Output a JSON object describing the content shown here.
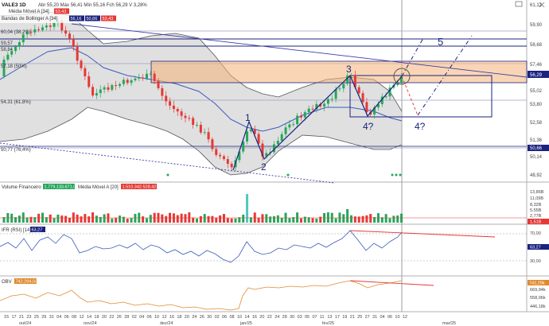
{
  "header": {
    "symbol": "VALE3 1D",
    "ohlc": "Abr 55,20 Máx 56,41 Mín 55,16 Fch 56,29 V 3,28%",
    "ma_label": "Média Móvel A [34]",
    "ma_value": "53,43",
    "bb_label": "Bandas de Bollinger A [34]",
    "bb_values": [
      "56,16",
      "50,66",
      "53,43"
    ]
  },
  "price_axis": {
    "ticks": [
      "61,12",
      "59,90",
      "58,68",
      "57,46",
      "55,02",
      "53,80",
      "52,58",
      "51,36",
      "50,14",
      "48,92"
    ],
    "current_price": "56,29",
    "level_5066": "50,66"
  },
  "fib_levels": [
    {
      "label": "60,04 (38,2%)"
    },
    {
      "label": "59,57"
    },
    {
      "label": "58,84"
    },
    {
      "label": "57,18 (50%)"
    },
    {
      "label": "54,31 (61,8%)"
    },
    {
      "label": "50,77 (76,4%)"
    }
  ],
  "wave_labels": [
    "1",
    "2",
    "3",
    "4?",
    "4?",
    "5"
  ],
  "volume_panel": {
    "title": "Volume Financeiro",
    "value": "1.779.133.671,00",
    "ma_title": "Média Móvel A [20]",
    "ma_value": "1.510.342.528,42",
    "ticks": [
      "13,86B",
      "11,09B",
      "8,32B",
      "5,55B",
      "2,77B"
    ],
    "current": "1,51B"
  },
  "rsi_panel": {
    "title": "IFR (RSI) [14]",
    "value": "63,27",
    "ticks": [
      "70,00",
      "30,00"
    ],
    "current": "63,27"
  },
  "obv_panel": {
    "title": "OBV",
    "value": "742.294,03",
    "ticks": [
      "742,29k",
      "669,94k",
      "558,06k",
      "446,18k"
    ],
    "current": "742,29k"
  },
  "time_axis": {
    "days": [
      "15",
      "17",
      "21",
      "23",
      "25",
      "29",
      "31",
      "04",
      "06",
      "08",
      "12",
      "14",
      "18",
      "20",
      "22",
      "26",
      "28",
      "02",
      "04",
      "06",
      "10",
      "12",
      "16",
      "18",
      "20",
      "24",
      "26",
      "30",
      "02",
      "06",
      "08",
      "10",
      "14",
      "16",
      "20",
      "22",
      "24",
      "28",
      "30",
      "03",
      "05",
      "07",
      "11",
      "13",
      "17",
      "19",
      "21",
      "25",
      "27",
      "31",
      "04",
      "06",
      "10",
      "12"
    ],
    "months": [
      "out/24",
      "nov/24",
      "dez/24",
      "jan/25",
      "fev/25",
      "mar/25"
    ]
  },
  "colors": {
    "up": "#26a65b",
    "down": "#e53935",
    "bollinger_fill": "#c7c7c7",
    "zone_fill": "#f4b37a",
    "wave_blue": "#1a237e",
    "price_tag": "#1a237e",
    "divergence": "#e53935",
    "obv_line": "#e08a2e",
    "rsi_line": "#3a5bbf"
  }
}
